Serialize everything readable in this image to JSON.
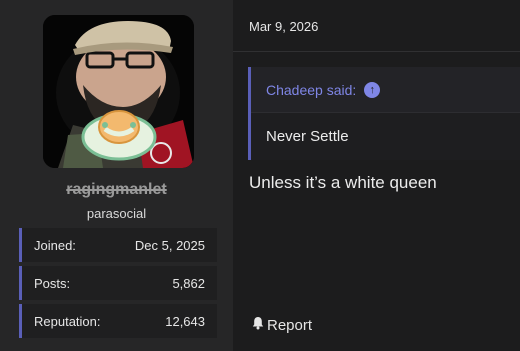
{
  "user": {
    "name": "ragingmanlet",
    "title": "parasocial",
    "stats": [
      {
        "label": "Joined:",
        "value": "Dec 5, 2025"
      },
      {
        "label": "Posts:",
        "value": "5,862"
      },
      {
        "label": "Reputation:",
        "value": "12,643"
      }
    ]
  },
  "post": {
    "date": "Mar 9, 2026",
    "quote": {
      "author_label": "Chadeep said:",
      "text": "Never Settle"
    },
    "body": "Unless it’s a white queen",
    "report_label": "Report"
  },
  "colors": {
    "accent": "#5a5fb8",
    "quote_author": "#7f86e6",
    "background": "#1c1c1d"
  },
  "icons": [
    "arrow-up-circle-icon",
    "bell-icon"
  ]
}
